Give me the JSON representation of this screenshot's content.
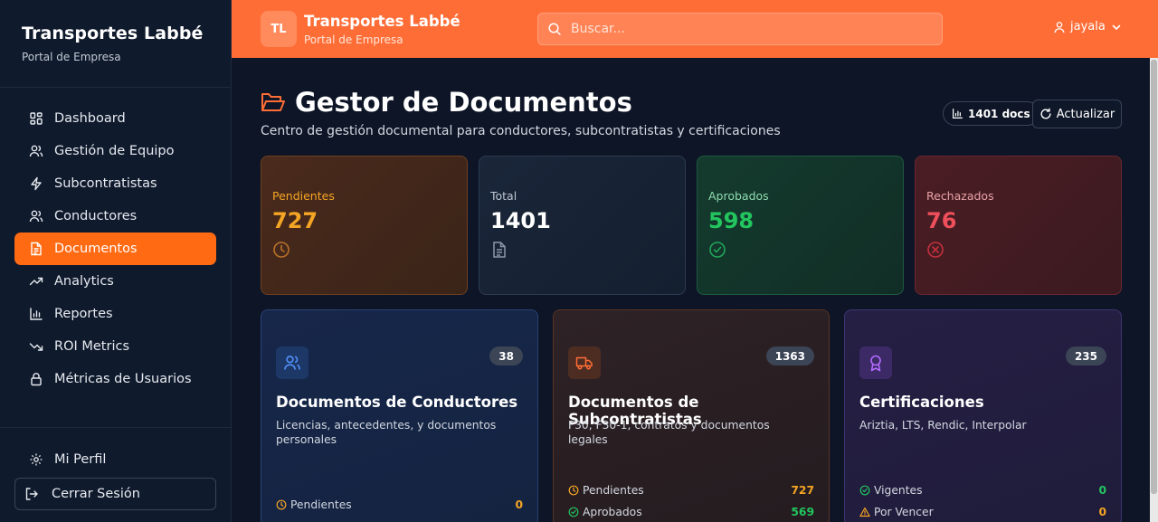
{
  "sidebar": {
    "brand_title": "Transportes Labbé",
    "brand_subtitle": "Portal de Empresa",
    "items": [
      {
        "label": "Dashboard",
        "icon": "dashboard-icon"
      },
      {
        "label": "Gestión de Equipo",
        "icon": "users-icon"
      },
      {
        "label": "Subcontratistas",
        "icon": "bolt-icon"
      },
      {
        "label": "Conductores",
        "icon": "users-icon"
      },
      {
        "label": "Documentos",
        "icon": "file-icon",
        "active": true
      },
      {
        "label": "Analytics",
        "icon": "trending-up-icon"
      },
      {
        "label": "Reportes",
        "icon": "bar-chart-icon"
      },
      {
        "label": "ROI Metrics",
        "icon": "trending-down-icon"
      },
      {
        "label": "Métricas de Usuarios",
        "icon": "lock-icon"
      }
    ],
    "profile_label": "Mi Perfil",
    "logout_label": "Cerrar Sesión"
  },
  "header": {
    "logo_initials": "TL",
    "title": "Transportes Labbé",
    "subtitle": "Portal de Empresa",
    "search_placeholder": "Buscar...",
    "username": "jayala",
    "accent_color": "#ff6d36"
  },
  "page": {
    "title": "Gestor de Documentos",
    "subtitle": "Centro de gestión documental para conductores, subcontratistas y certificaciones",
    "docs_badge": "1401 docs",
    "refresh_label": "Actualizar"
  },
  "stats": [
    {
      "label": "Pendientes",
      "value": "727",
      "color": "#f5a524",
      "icon": "clock-icon"
    },
    {
      "label": "Total",
      "value": "1401",
      "color": "#ffffff",
      "icon": "file-icon"
    },
    {
      "label": "Aprobados",
      "value": "598",
      "color": "#22c55e",
      "icon": "check-circle-icon"
    },
    {
      "label": "Rechazados",
      "value": "76",
      "color": "#ef4f5a",
      "icon": "x-circle-icon"
    }
  ],
  "cards": [
    {
      "title": "Documentos de Conductores",
      "description": "Licencias, antecedentes, y documentos personales",
      "count": "38",
      "icon": "users-icon",
      "rows": [
        {
          "label": "Pendientes",
          "value": "0",
          "icon": "clock-icon"
        }
      ]
    },
    {
      "title": "Documentos de Subcontratistas",
      "description": "F30, F30-1, contratos y documentos legales",
      "count": "1363",
      "icon": "truck-icon",
      "rows": [
        {
          "label": "Pendientes",
          "value": "727",
          "icon": "clock-icon"
        },
        {
          "label": "Aprobados",
          "value": "569",
          "icon": "check-circle-icon"
        }
      ]
    },
    {
      "title": "Certificaciones",
      "description": "Ariztia, LTS, Rendic, Interpolar",
      "count": "235",
      "icon": "award-icon",
      "rows": [
        {
          "label": "Vigentes",
          "value": "0",
          "icon": "check-circle-icon"
        },
        {
          "label": "Por Vencer",
          "value": "0",
          "icon": "alert-triangle-icon"
        }
      ]
    }
  ]
}
